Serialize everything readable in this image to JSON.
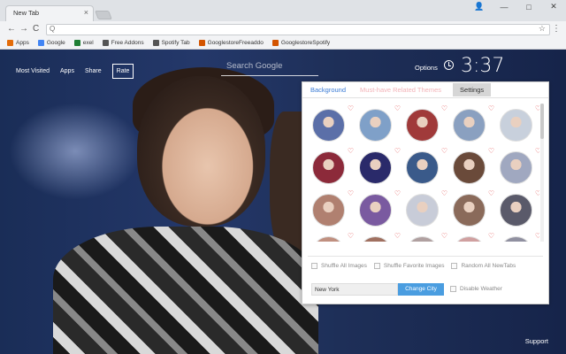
{
  "browser": {
    "tab_title": "New Tab",
    "tab_close": "×",
    "window_controls": [
      "👤",
      "—",
      "□",
      "✕"
    ],
    "nav": {
      "back": "←",
      "forward": "→",
      "reload": "C"
    },
    "omnibox_icons": {
      "search": "Q",
      "star": "☆"
    },
    "menu": "⋮",
    "bookmarks": [
      {
        "label": "Apps",
        "color": "#e36c0a"
      },
      {
        "label": "Google",
        "color": "#4285f4"
      },
      {
        "label": "exel",
        "color": "#1e7e34"
      },
      {
        "label": "Free Addons",
        "color": "#555555"
      },
      {
        "label": "Spotify Tab",
        "color": "#555555"
      },
      {
        "label": "GooglestoreFreeaddo",
        "color": "#d35400"
      },
      {
        "label": "GooglestoreSpotify",
        "color": "#d35400"
      }
    ]
  },
  "newtab": {
    "nav": [
      "Most Visited",
      "Apps",
      "Share",
      "Rate"
    ],
    "search_placeholder": "Search Google",
    "options": "Options",
    "time": "3:37",
    "support": "Support"
  },
  "panel": {
    "tabs": [
      "Background",
      "Must-have Related Themes",
      "Settings"
    ],
    "thumb_colors": [
      "#5b6fa8",
      "#7fa0c8",
      "#a03a3a",
      "#8aa0c0",
      "#c8d0dc",
      "#8c2a3a",
      "#2a2a6a",
      "#3a5a8a",
      "#6a4a3a",
      "#a0a8c0",
      "#b08070",
      "#7a5aa0",
      "#c8ccd8",
      "#8a6a5a",
      "#5a5a6a",
      "#c09080",
      "#a07060",
      "#b0a0a0",
      "#d0a0a0",
      "#9090a0"
    ],
    "heart": "♡",
    "checkboxes": [
      "Shuffle All Images",
      "Shuffle Favorite Images",
      "Random All NewTabs"
    ],
    "city_value": "New York",
    "city_button": "Change City",
    "weather_label": "Disable Weather"
  }
}
